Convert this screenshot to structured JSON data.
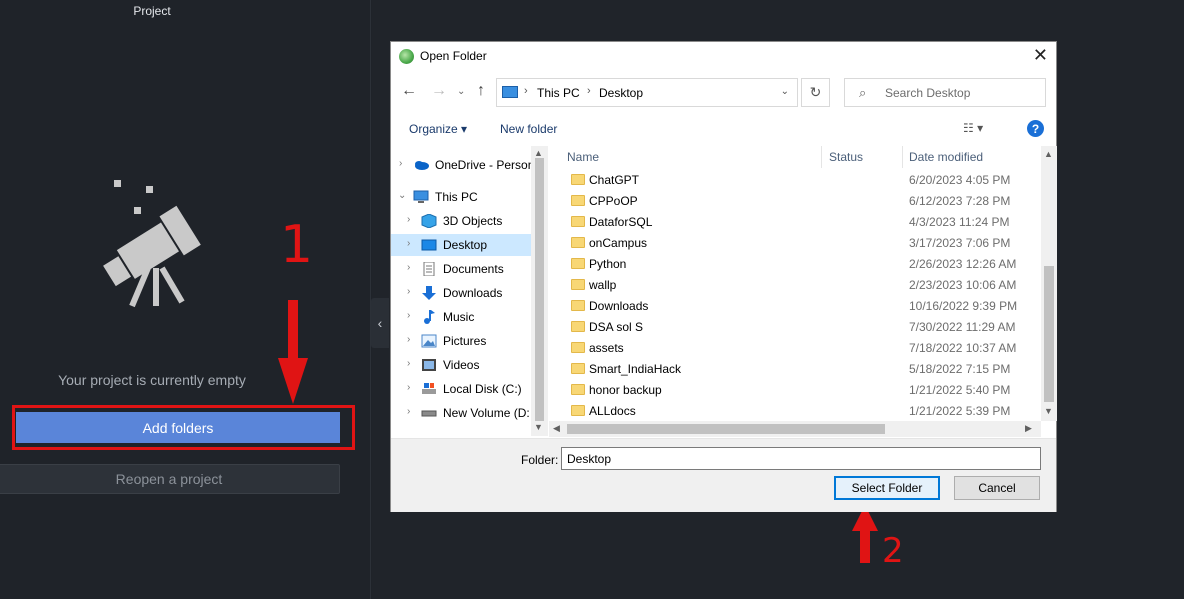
{
  "app": {
    "project_label": "Project",
    "empty_text": "Your project is currently empty",
    "add_folders_label": "Add folders",
    "reopen_label": "Reopen a project",
    "collapse_glyph": "‹"
  },
  "annotations": {
    "step1": "1",
    "step2": "2",
    "color": "#e01414"
  },
  "dialog": {
    "title": "Open Folder",
    "close_glyph": "✕",
    "address": {
      "crumbs": [
        "This PC",
        "Desktop"
      ]
    },
    "search_placeholder": "Search Desktop",
    "toolbar": {
      "organize": "Organize ▾",
      "new_folder": "New folder",
      "help": "?"
    },
    "tree": [
      {
        "label": "OneDrive - Person",
        "icon": "onedrive-icon"
      },
      {
        "label": "This PC",
        "icon": "computer-icon",
        "expanded": true
      },
      {
        "label": "3D Objects",
        "icon": "cube-icon"
      },
      {
        "label": "Desktop",
        "icon": "desktop-icon",
        "selected": true
      },
      {
        "label": "Documents",
        "icon": "documents-icon"
      },
      {
        "label": "Downloads",
        "icon": "download-icon"
      },
      {
        "label": "Music",
        "icon": "music-icon"
      },
      {
        "label": "Pictures",
        "icon": "pictures-icon"
      },
      {
        "label": "Videos",
        "icon": "videos-icon"
      },
      {
        "label": "Local Disk (C:)",
        "icon": "disk-icon"
      },
      {
        "label": "New Volume (D:",
        "icon": "drive-icon"
      }
    ],
    "columns": {
      "name": "Name",
      "status": "Status",
      "date_modified": "Date modified"
    },
    "files": [
      {
        "name": "ChatGPT",
        "date": "6/20/2023 4:05 PM"
      },
      {
        "name": "CPPoOP",
        "date": "6/12/2023 7:28 PM"
      },
      {
        "name": "DataforSQL",
        "date": "4/3/2023 11:24 PM"
      },
      {
        "name": "onCampus",
        "date": "3/17/2023 7:06 PM"
      },
      {
        "name": "Python",
        "date": "2/26/2023 12:26 AM"
      },
      {
        "name": "wallp",
        "date": "2/23/2023 10:06 AM"
      },
      {
        "name": "Downloads",
        "date": "10/16/2022 9:39 PM"
      },
      {
        "name": "DSA sol S",
        "date": "7/30/2022 11:29 AM"
      },
      {
        "name": "assets",
        "date": "7/18/2022 10:37 AM"
      },
      {
        "name": "Smart_IndiaHack",
        "date": "5/18/2022 7:15 PM"
      },
      {
        "name": "honor backup",
        "date": "1/21/2022 5:40 PM"
      },
      {
        "name": "ALLdocs",
        "date": "1/21/2022 5:39 PM"
      }
    ],
    "folder_label": "Folder:",
    "folder_value": "Desktop",
    "select_folder": "Select Folder",
    "cancel": "Cancel"
  }
}
